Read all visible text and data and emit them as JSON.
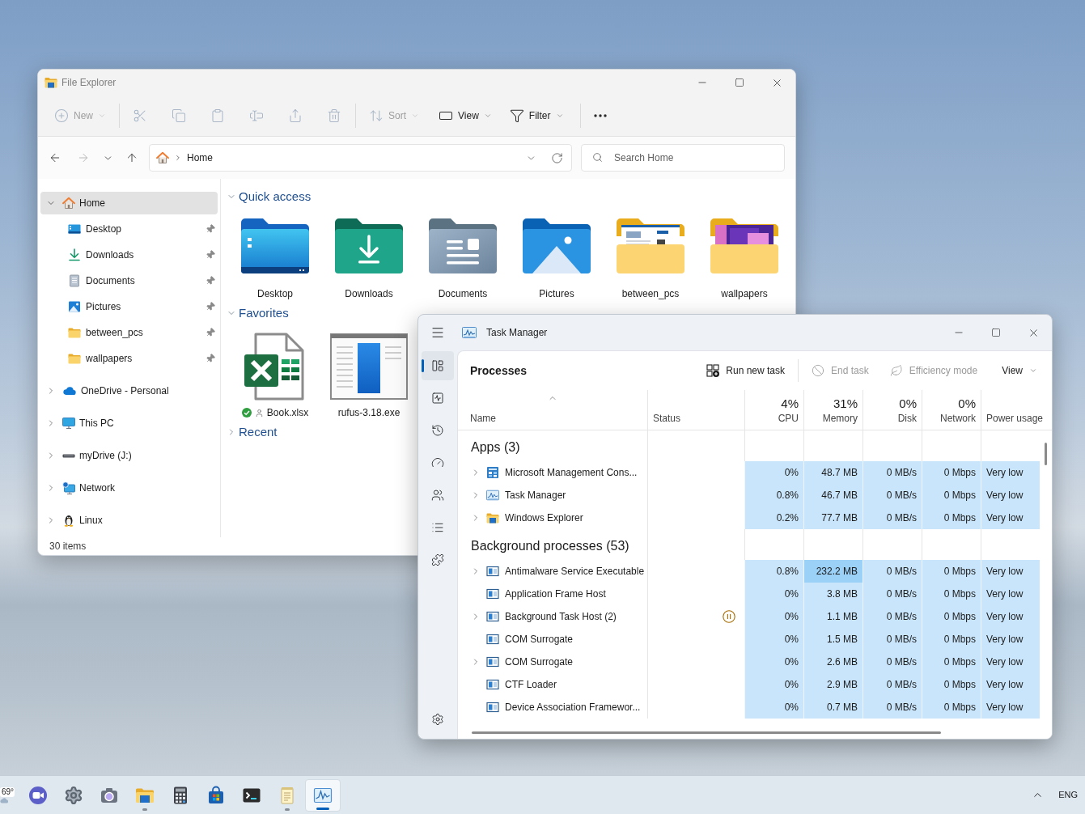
{
  "file_explorer": {
    "title": "File Explorer",
    "toolbar": {
      "new": {
        "label": "New",
        "disabled": true
      },
      "edit_actions": [
        {
          "disabled": true
        },
        {
          "disabled": true
        },
        {
          "disabled": true
        },
        {
          "disabled": true
        },
        {
          "disabled": true
        },
        {
          "disabled": true
        }
      ],
      "sort": {
        "label": "Sort",
        "disabled": true
      },
      "view": {
        "label": "View",
        "disabled": false
      },
      "filter": {
        "label": "Filter",
        "disabled": false
      }
    },
    "navigation": {
      "back_disabled": false,
      "forward_disabled": true,
      "up_disabled": false
    },
    "address": {
      "segments": [
        "Home"
      ]
    },
    "search": {
      "placeholder": "Search Home"
    },
    "sidebar": {
      "items": [
        {
          "label": "Home",
          "selected": true,
          "expanded": true,
          "children": [
            {
              "label": "Desktop",
              "selected": false,
              "pinned": true
            },
            {
              "label": "Downloads",
              "selected": false,
              "pinned": true
            },
            {
              "label": "Documents",
              "selected": false,
              "pinned": true
            },
            {
              "label": "Pictures",
              "selected": false,
              "pinned": true
            },
            {
              "label": "between_pcs",
              "selected": false,
              "pinned": true
            },
            {
              "label": "wallpapers",
              "selected": false,
              "pinned": true
            }
          ]
        },
        {
          "label": "OneDrive - Personal",
          "selected": false,
          "expanded": false
        },
        {
          "label": "This PC",
          "selected": false,
          "expanded": false
        },
        {
          "label": "myDrive (J:)",
          "selected": false,
          "expanded": false
        },
        {
          "label": "Network",
          "selected": false,
          "expanded": false
        },
        {
          "label": "Linux",
          "selected": false,
          "expanded": false
        }
      ]
    },
    "sections": [
      {
        "title": "Quick access",
        "expanded": true,
        "items": [
          {
            "label": "Desktop"
          },
          {
            "label": "Downloads"
          },
          {
            "label": "Documents"
          },
          {
            "label": "Pictures"
          },
          {
            "label": "between_pcs"
          },
          {
            "label": "wallpapers"
          }
        ]
      },
      {
        "title": "Favorites",
        "expanded": true,
        "items": [
          {
            "label": "Book.xlsx",
            "synced": true,
            "shared": true
          },
          {
            "label": "rufus-3.18.exe",
            "synced": false,
            "shared": false
          }
        ]
      },
      {
        "title": "Recent",
        "expanded": false
      }
    ],
    "status_bar": {
      "item_count": "30 items"
    }
  },
  "task_manager": {
    "title": "Task Manager",
    "nav": [
      {
        "selected": true
      },
      {
        "selected": false
      },
      {
        "selected": false
      },
      {
        "selected": false
      },
      {
        "selected": false
      },
      {
        "selected": false
      },
      {
        "selected": false
      }
    ],
    "page_title": "Processes",
    "actions": [
      {
        "label": "Run new task",
        "disabled": false
      },
      {
        "label": "End task",
        "disabled": true
      },
      {
        "label": "Efficiency mode",
        "disabled": true
      }
    ],
    "view_menu": {
      "label": "View"
    },
    "columns": [
      {
        "label": "Name",
        "sorted": true
      },
      {
        "label": "Status",
        "sorted": false
      },
      {
        "label": "CPU",
        "total": "4%",
        "sorted": false
      },
      {
        "label": "Memory",
        "total": "31%",
        "sorted": false
      },
      {
        "label": "Disk",
        "total": "0%",
        "sorted": false
      },
      {
        "label": "Network",
        "total": "0%",
        "sorted": false
      },
      {
        "label": "Power usage",
        "sorted": false
      }
    ],
    "groups": [
      {
        "title": "Apps (3)",
        "rows": [
          {
            "name": "Microsoft Management Cons...",
            "expandable": true,
            "suspended": false,
            "memory_high": false,
            "values": [
              "0%",
              "48.7 MB",
              "0 MB/s",
              "0 Mbps",
              "Very low"
            ]
          },
          {
            "name": "Task Manager",
            "expandable": true,
            "suspended": false,
            "memory_high": false,
            "values": [
              "0.8%",
              "46.7 MB",
              "0 MB/s",
              "0 Mbps",
              "Very low"
            ]
          },
          {
            "name": "Windows Explorer",
            "expandable": true,
            "suspended": false,
            "memory_high": false,
            "values": [
              "0.2%",
              "77.7 MB",
              "0 MB/s",
              "0 Mbps",
              "Very low"
            ]
          }
        ]
      },
      {
        "title": "Background processes (53)",
        "rows": [
          {
            "name": "Antimalware Service Executable",
            "expandable": true,
            "suspended": false,
            "memory_high": true,
            "values": [
              "0.8%",
              "232.2 MB",
              "0 MB/s",
              "0 Mbps",
              "Very low"
            ]
          },
          {
            "name": "Application Frame Host",
            "expandable": false,
            "suspended": false,
            "memory_high": false,
            "values": [
              "0%",
              "3.8 MB",
              "0 MB/s",
              "0 Mbps",
              "Very low"
            ]
          },
          {
            "name": "Background Task Host (2)",
            "expandable": true,
            "suspended": true,
            "memory_high": false,
            "values": [
              "0%",
              "1.1 MB",
              "0 MB/s",
              "0 Mbps",
              "Very low"
            ]
          },
          {
            "name": "COM Surrogate",
            "expandable": false,
            "suspended": false,
            "memory_high": false,
            "values": [
              "0%",
              "1.5 MB",
              "0 MB/s",
              "0 Mbps",
              "Very low"
            ]
          },
          {
            "name": "COM Surrogate",
            "expandable": true,
            "suspended": false,
            "memory_high": false,
            "values": [
              "0%",
              "2.6 MB",
              "0 MB/s",
              "0 Mbps",
              "Very low"
            ]
          },
          {
            "name": "CTF Loader",
            "expandable": false,
            "suspended": false,
            "memory_high": false,
            "values": [
              "0%",
              "2.9 MB",
              "0 MB/s",
              "0 Mbps",
              "Very low"
            ]
          },
          {
            "name": "Device Association Framewor...",
            "expandable": false,
            "suspended": false,
            "memory_high": false,
            "values": [
              "0%",
              "0.7 MB",
              "0 MB/s",
              "0 Mbps",
              "Very low"
            ]
          }
        ]
      }
    ]
  },
  "taskbar": {
    "weather": "69°",
    "apps": [
      {
        "running": false,
        "selected": false
      },
      {
        "running": false,
        "selected": false
      },
      {
        "running": false,
        "selected": false
      },
      {
        "running": true,
        "selected": false
      },
      {
        "running": false,
        "selected": false
      },
      {
        "running": false,
        "selected": false
      },
      {
        "running": false,
        "selected": false
      },
      {
        "running": true,
        "selected": false
      },
      {
        "running": true,
        "selected": true
      }
    ],
    "language": "ENG"
  }
}
